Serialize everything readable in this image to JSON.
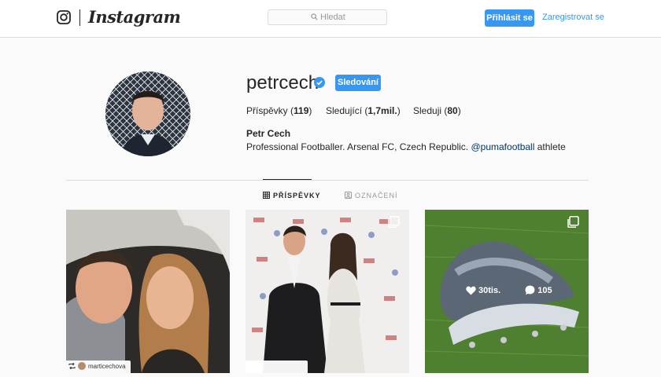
{
  "header": {
    "brand": "Instagram",
    "search_placeholder": "Hledat",
    "login_label": "Přihlásit se",
    "register_label": "Zaregistrovat se"
  },
  "profile": {
    "username": "petrcech",
    "follow_label": "Sledování",
    "stats": {
      "posts_label": "Příspěvky",
      "posts_count": "119",
      "followers_label": "Sledující",
      "followers_count": "1,7mil.",
      "following_label": "Sleduji",
      "following_count": "80"
    },
    "full_name": "Petr Cech",
    "bio_text": "Professional Footballer. Arsenal FC, Czech Republic.",
    "bio_mention": "@pumafootball",
    "bio_suffix": "athlete"
  },
  "tabs": {
    "posts_label": "PŘÍSPĚVKY",
    "tagged_label": "OZNAČENÍ"
  },
  "posts": [
    {
      "repost_user": "marticechova"
    },
    {
      "repost_user": ""
    },
    {
      "likes": "30tis.",
      "comments": "105"
    }
  ],
  "colors": {
    "accent": "#3897f0",
    "verified": "#3897f0"
  },
  "icons": [
    "instagram-camera-icon",
    "search-icon",
    "verified-badge-icon",
    "grid-icon",
    "tag-icon",
    "multi-image-icon",
    "heart-icon",
    "comment-icon",
    "repost-icon"
  ]
}
